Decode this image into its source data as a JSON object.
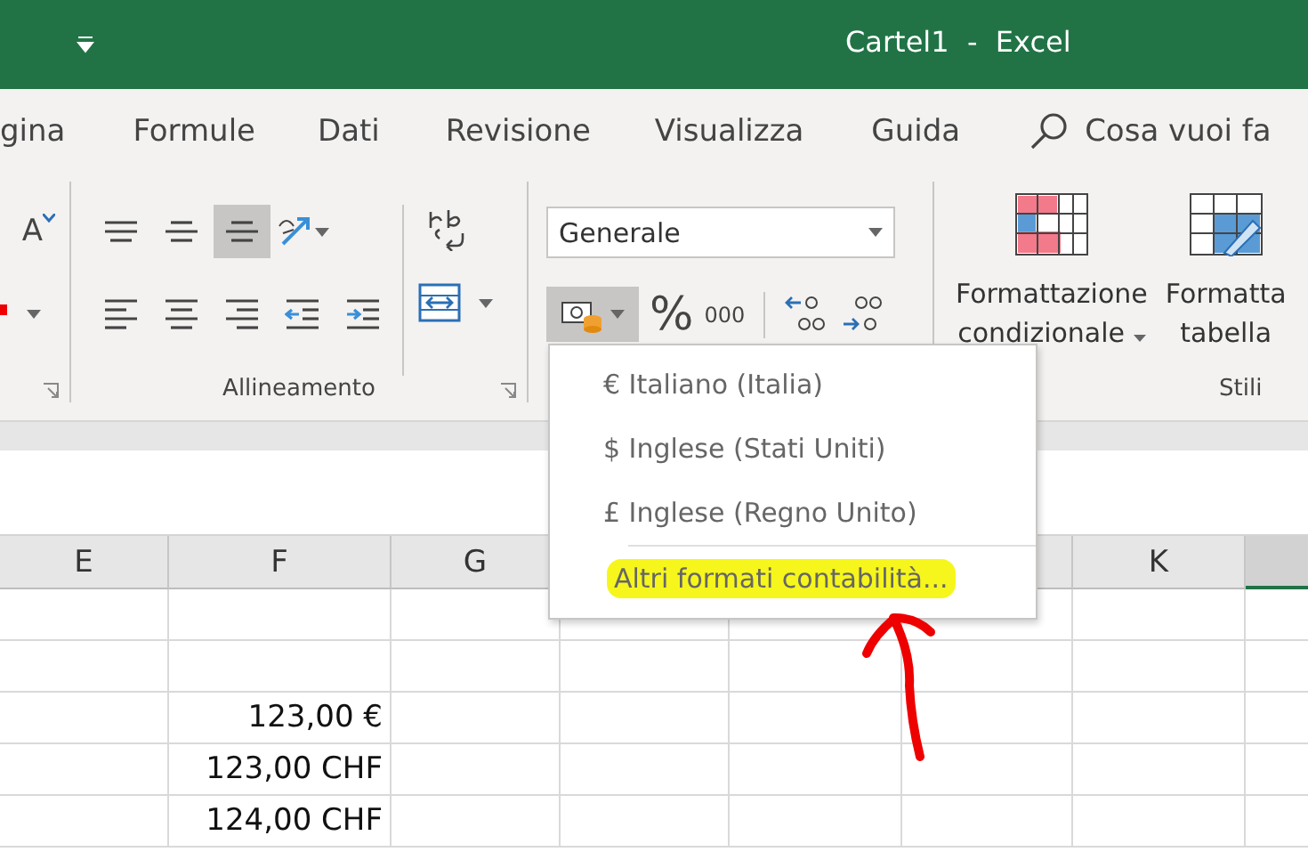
{
  "title_bar": {
    "title": "Cartel1  -  Excel"
  },
  "tabs": [
    {
      "label": "gina"
    },
    {
      "label": "Formule"
    },
    {
      "label": "Dati"
    },
    {
      "label": "Revisione"
    },
    {
      "label": "Visualizza"
    },
    {
      "label": "Guida"
    }
  ],
  "search": {
    "placeholder": "Cosa vuoi fa"
  },
  "font_group": {
    "grow_glyph": "A"
  },
  "alignment": {
    "label": "Allineamento",
    "top_row": [
      {
        "kind": "align-top",
        "selected": false
      },
      {
        "kind": "align-middle",
        "selected": false
      },
      {
        "kind": "align-bottom",
        "selected": true
      },
      {
        "kind": "orientation",
        "selected": false
      }
    ],
    "bottom_row": [
      {
        "kind": "left",
        "selected": false
      },
      {
        "kind": "center",
        "selected": false
      },
      {
        "kind": "right",
        "selected": false
      },
      {
        "kind": "outdent",
        "selected": false
      },
      {
        "kind": "indent",
        "selected": false
      }
    ]
  },
  "number": {
    "format": "Generale",
    "accounting_pressed": true,
    "percent": "%",
    "thousands": "000"
  },
  "styles": {
    "conditional": [
      "Formattazione",
      "condizionale"
    ],
    "format_table": [
      "Formatta",
      "tabella"
    ],
    "label": "Stili"
  },
  "accounting_menu": {
    "items": [
      {
        "label": "€ Italiano (Italia)",
        "highlighted": false
      },
      {
        "label": "$ Inglese (Stati Uniti)",
        "highlighted": false
      },
      {
        "label": "£ Inglese (Regno Unito)",
        "highlighted": false
      },
      {
        "label": "Altri formati contabilità...",
        "highlighted": true
      }
    ]
  },
  "sheet": {
    "columns": [
      {
        "label": "E",
        "selected": false
      },
      {
        "label": "F",
        "selected": false
      },
      {
        "label": "G",
        "selected": false
      },
      {},
      {},
      {},
      {
        "label": "K",
        "selected": false
      },
      {
        "selected": true
      }
    ],
    "rows": [
      {},
      {},
      {
        "F": "123,00 €"
      },
      {
        "F": "123,00 CHF"
      },
      {
        "F": "124,00 CHF"
      }
    ]
  }
}
